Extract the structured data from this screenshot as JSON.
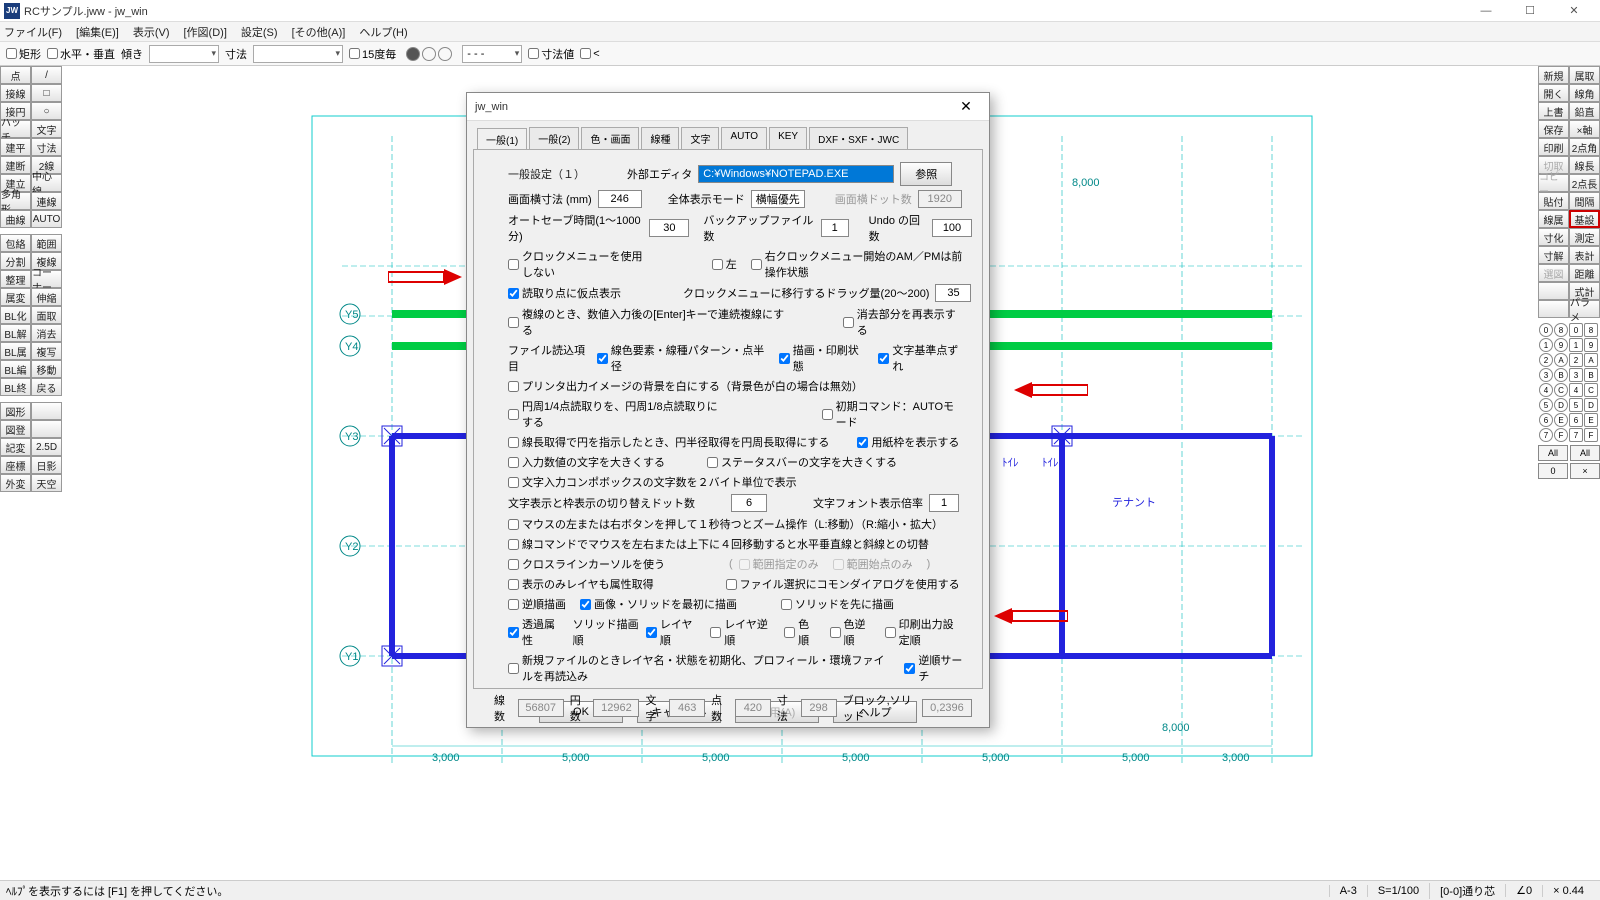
{
  "title": "RCサンプル.jww - jw_win",
  "menus": [
    "ファイル(F)",
    "[編集(E)]",
    "表示(V)",
    "[作図(D)]",
    "設定(S)",
    "[その他(A)]",
    "ヘルプ(H)"
  ],
  "optbar": {
    "rect": "矩形",
    "hv": "水平・垂直",
    "incline": "傾き",
    "dim": "寸法",
    "deg15": "15度毎",
    "dashed": "- - -",
    "dimval": "寸法値",
    "lt": "<"
  },
  "left_tools": [
    [
      "点",
      "/"
    ],
    [
      "接線",
      "□"
    ],
    [
      "接円",
      "○"
    ],
    [
      "ハッチ",
      "文字"
    ],
    [
      "建平",
      "寸法"
    ],
    [
      "建断",
      "2線"
    ],
    [
      "建立",
      "中心線"
    ],
    [
      "多角形",
      "連線"
    ],
    [
      "曲線",
      "AUTO"
    ],
    null,
    [
      "包絡",
      "範囲"
    ],
    [
      "分割",
      "複線"
    ],
    [
      "整理",
      "コーナー"
    ],
    [
      "属変",
      "伸縮"
    ],
    [
      "BL化",
      "面取"
    ],
    [
      "BL解",
      "消去"
    ],
    [
      "BL属",
      "複写"
    ],
    [
      "BL編",
      "移動"
    ],
    [
      "BL終",
      "戻る"
    ],
    null,
    [
      "図形",
      ""
    ],
    [
      "図登",
      ""
    ],
    [
      "記変",
      "2.5D"
    ],
    [
      "座標",
      "日影"
    ],
    [
      "外変",
      "天空"
    ]
  ],
  "right_tools": [
    [
      "新規",
      "属取"
    ],
    [
      "開く",
      "線角"
    ],
    [
      "上書",
      "鉛直"
    ],
    [
      "保存",
      "×軸"
    ],
    [
      "印刷",
      "2点角"
    ],
    [
      "切取",
      "線長"
    ],
    [
      "コピー",
      "2点長"
    ],
    [
      "貼付",
      "間隔"
    ],
    [
      "線属",
      "基設"
    ],
    null,
    [
      "寸化",
      "測定"
    ],
    [
      "寸解",
      "表計"
    ],
    [
      "選図",
      "距離"
    ],
    [
      "",
      "式計"
    ],
    [
      "",
      "パラメ"
    ]
  ],
  "right_disabled": [
    "切取",
    "コピー",
    "選図"
  ],
  "right_highlight": "基設",
  "layer_grid": [
    [
      "0",
      "8",
      "0",
      "8"
    ],
    [
      "1",
      "9",
      "1",
      "9"
    ],
    [
      "2",
      "A",
      "2",
      "A"
    ],
    [
      "3",
      "B",
      "3",
      "B"
    ],
    [
      "4",
      "C",
      "4",
      "C"
    ],
    [
      "5",
      "D",
      "5",
      "D"
    ],
    [
      "6",
      "E",
      "6",
      "E"
    ],
    [
      "7",
      "F",
      "7",
      "F"
    ]
  ],
  "all_label": "All",
  "zero_label": "0",
  "x_label": "×",
  "dialog": {
    "title": "jw_win",
    "tabs": [
      "一般(1)",
      "一般(2)",
      "色・画面",
      "線種",
      "文字",
      "AUTO",
      "KEY",
      "DXF・SXF・JWC"
    ],
    "section": "一般設定（１）",
    "ext_editor_lbl": "外部エディタ",
    "ext_editor_val": "C:¥Windows¥NOTEPAD.EXE",
    "browse": "参照",
    "screen_w_lbl": "画面横寸法 (mm)",
    "screen_w": "246",
    "disp_mode_lbl": "全体表示モード",
    "disp_mode": "横幅優先",
    "dots_lbl": "画面横ドット数",
    "dots": "1920",
    "autosave_lbl": "オートセーブ時間(1～1000分)",
    "autosave": "30",
    "backup_lbl": "バックアップファイル数",
    "backup": "1",
    "undo_lbl": "Undo の回数",
    "undo": "100",
    "clock_menu": "クロックメニューを使用しない",
    "left": "左",
    "right_clock": "右クロックメニュー開始のAM／PMは前操作状態",
    "read_pt": "読取り点に仮点表示",
    "clock_drag": "クロックメニューに移行するドラッグ量(20～200)",
    "clock_drag_val": "35",
    "multi_enter": "複線のとき、数値入力後の[Enter]キーで連続複線にする",
    "erase_re": "消去部分を再表示する",
    "file_read_lbl": "ファイル読込項目",
    "line_elem": "線色要素・線種パターン・点半径",
    "draw_print": "描画・印刷状態",
    "char_base": "文字基準点ずれ",
    "printer_bg": "プリンタ出力イメージの背景を白にする（背景色が白の場合は無効）",
    "circle_8": "円周1/4点読取りを、円周1/8点読取りにする",
    "init_cmd": "初期コマンド：AUTOモード",
    "circle_len": "線長取得で円を指示したとき、円半径取得を円周長取得にする",
    "paper_frame": "用紙枠を表示する",
    "input_big": "入力数値の文字を大きくする",
    "status_big": "ステータスバーの文字を大きくする",
    "combo2b": "文字入力コンポボックスの文字数を２バイト単位で表示",
    "char_switch_lbl": "文字表示と枠表示の切り替えドット数",
    "char_switch": "6",
    "font_mag_lbl": "文字フォント表示倍率",
    "font_mag": "1",
    "mouse_wait": "マウスの左または右ボタンを押して１秒待つとズーム操作（L:移動）（R:縮小・拡大）",
    "line4move": "線コマンドでマウスを左右または上下に４回移動すると水平垂直線と斜線との切替",
    "crossline": "クロスラインカーソルを使う",
    "range_only": "範囲指定のみ",
    "range_start": "範囲始点のみ",
    "disp_layer": "表示のみレイヤも属性取得",
    "file_common": "ファイル選択にコモンダイアログを使用する",
    "rev_draw": "逆順描画",
    "img_first": "画像・ソリッドを最初に描画",
    "solid_first": "ソリッドを先に描画",
    "trans": "透過属性",
    "solid_ord": "ソリッド描画順",
    "layer_ord": "レイヤ順",
    "layer_rev": "レイヤ逆順",
    "col_ord": "色順",
    "col_rev": "色逆順",
    "print_set": "印刷出力設定順",
    "new_init": "新規ファイルのときレイヤ名・状態を初期化、プロフィール・環境ファイルを再読込み",
    "rev_search": "逆順サーチ",
    "stats": {
      "lines_lbl": "線数",
      "lines": "56807",
      "circles_lbl": "円数",
      "circles": "12962",
      "chars_lbl": "文字",
      "chars": "463",
      "pts_lbl": "点数",
      "pts": "420",
      "dims_lbl": "寸法",
      "dims": "298",
      "blk_lbl": "ブロック,ソリッド",
      "blk": "0,2396"
    },
    "ok": "OK",
    "cancel": "キャンセル",
    "apply": "適用(A)",
    "help": "ヘルプ"
  },
  "status": {
    "hint": "ﾍﾙﾌﾟを表示するには [F1] を押してください。",
    "paper": "A-3",
    "scale": "S=1/100",
    "angle": "∠0",
    "layer": "[0-0]通り芯",
    "x": "× 0.44"
  }
}
